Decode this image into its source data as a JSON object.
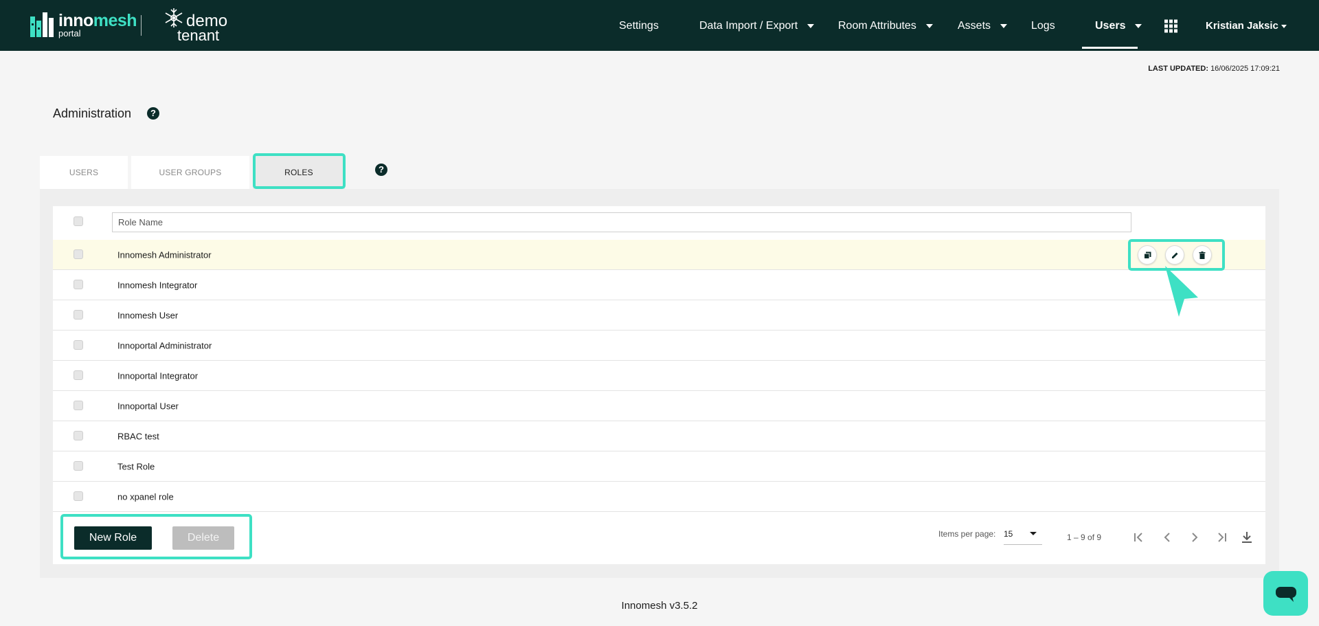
{
  "header": {
    "brand_primary": "inno",
    "brand_secondary": "mesh",
    "brand_sub": "portal",
    "tenant_line1": "demo",
    "tenant_line2": "tenant",
    "nav": {
      "settings": "Settings",
      "data_import": "Data Import / Export",
      "room_attributes": "Room Attributes",
      "assets": "Assets",
      "logs": "Logs",
      "users": "Users",
      "user_menu": "Kristian Jaksic"
    }
  },
  "status": {
    "last_updated_label": "LAST UPDATED:",
    "last_updated_value": "16/06/2025 17:09:21"
  },
  "page": {
    "title": "Administration"
  },
  "tabs": [
    {
      "label": "USERS",
      "active": false
    },
    {
      "label": "USER GROUPS",
      "active": false
    },
    {
      "label": "ROLES",
      "active": true
    }
  ],
  "table": {
    "filter_placeholder": "Role Name",
    "rows": [
      {
        "name": "Innomesh Administrator"
      },
      {
        "name": "Innomesh Integrator"
      },
      {
        "name": "Innomesh User"
      },
      {
        "name": "Innoportal Administrator"
      },
      {
        "name": "Innoportal Integrator"
      },
      {
        "name": "Innoportal User"
      },
      {
        "name": "RBAC test"
      },
      {
        "name": "Test Role"
      },
      {
        "name": "no xpanel role"
      }
    ],
    "row_actions": [
      "copy-icon",
      "edit-icon",
      "delete-icon"
    ]
  },
  "actions": {
    "new_role": "New Role",
    "delete": "Delete"
  },
  "pagination": {
    "items_per_page_label": "Items per page:",
    "items_per_page_value": "15",
    "range": "1 – 9 of 9"
  },
  "footer": {
    "version": "Innomesh v3.5.2"
  },
  "colors": {
    "header_bg": "#0b2c2a",
    "accent": "#3ee0c4",
    "hover_row": "#fdfbe7"
  }
}
